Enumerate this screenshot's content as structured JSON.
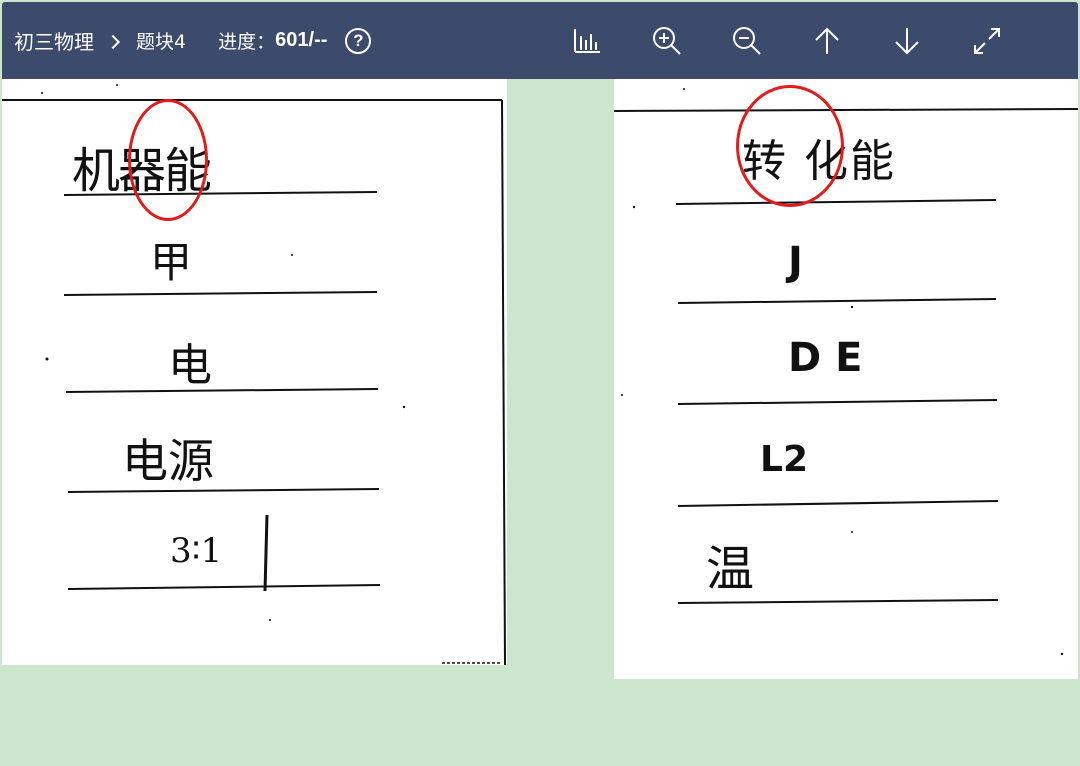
{
  "toolbar": {
    "subject": "初三物理",
    "block": "题块4",
    "progress_label": "进度：",
    "progress_value": "601/--",
    "help_glyph": "?",
    "tools": [
      {
        "name": "statistics-icon"
      },
      {
        "name": "zoom-in-icon"
      },
      {
        "name": "zoom-out-icon"
      },
      {
        "name": "arrow-up-icon"
      },
      {
        "name": "arrow-down-icon"
      },
      {
        "name": "fullscreen-icon"
      }
    ]
  },
  "colors": {
    "toolbar_bg": "#3c4a6b",
    "background": "#cbe6cd",
    "sheet": "#ffffff",
    "annotation": "#e31b1b",
    "ink": "#111111"
  },
  "answer_sheets": {
    "left": {
      "answers": [
        "机器能",
        "甲",
        "电",
        "电源",
        "3∶1"
      ]
    },
    "right": {
      "answers": [
        "转 化能",
        "J",
        "D E",
        "L2",
        "温"
      ]
    }
  }
}
